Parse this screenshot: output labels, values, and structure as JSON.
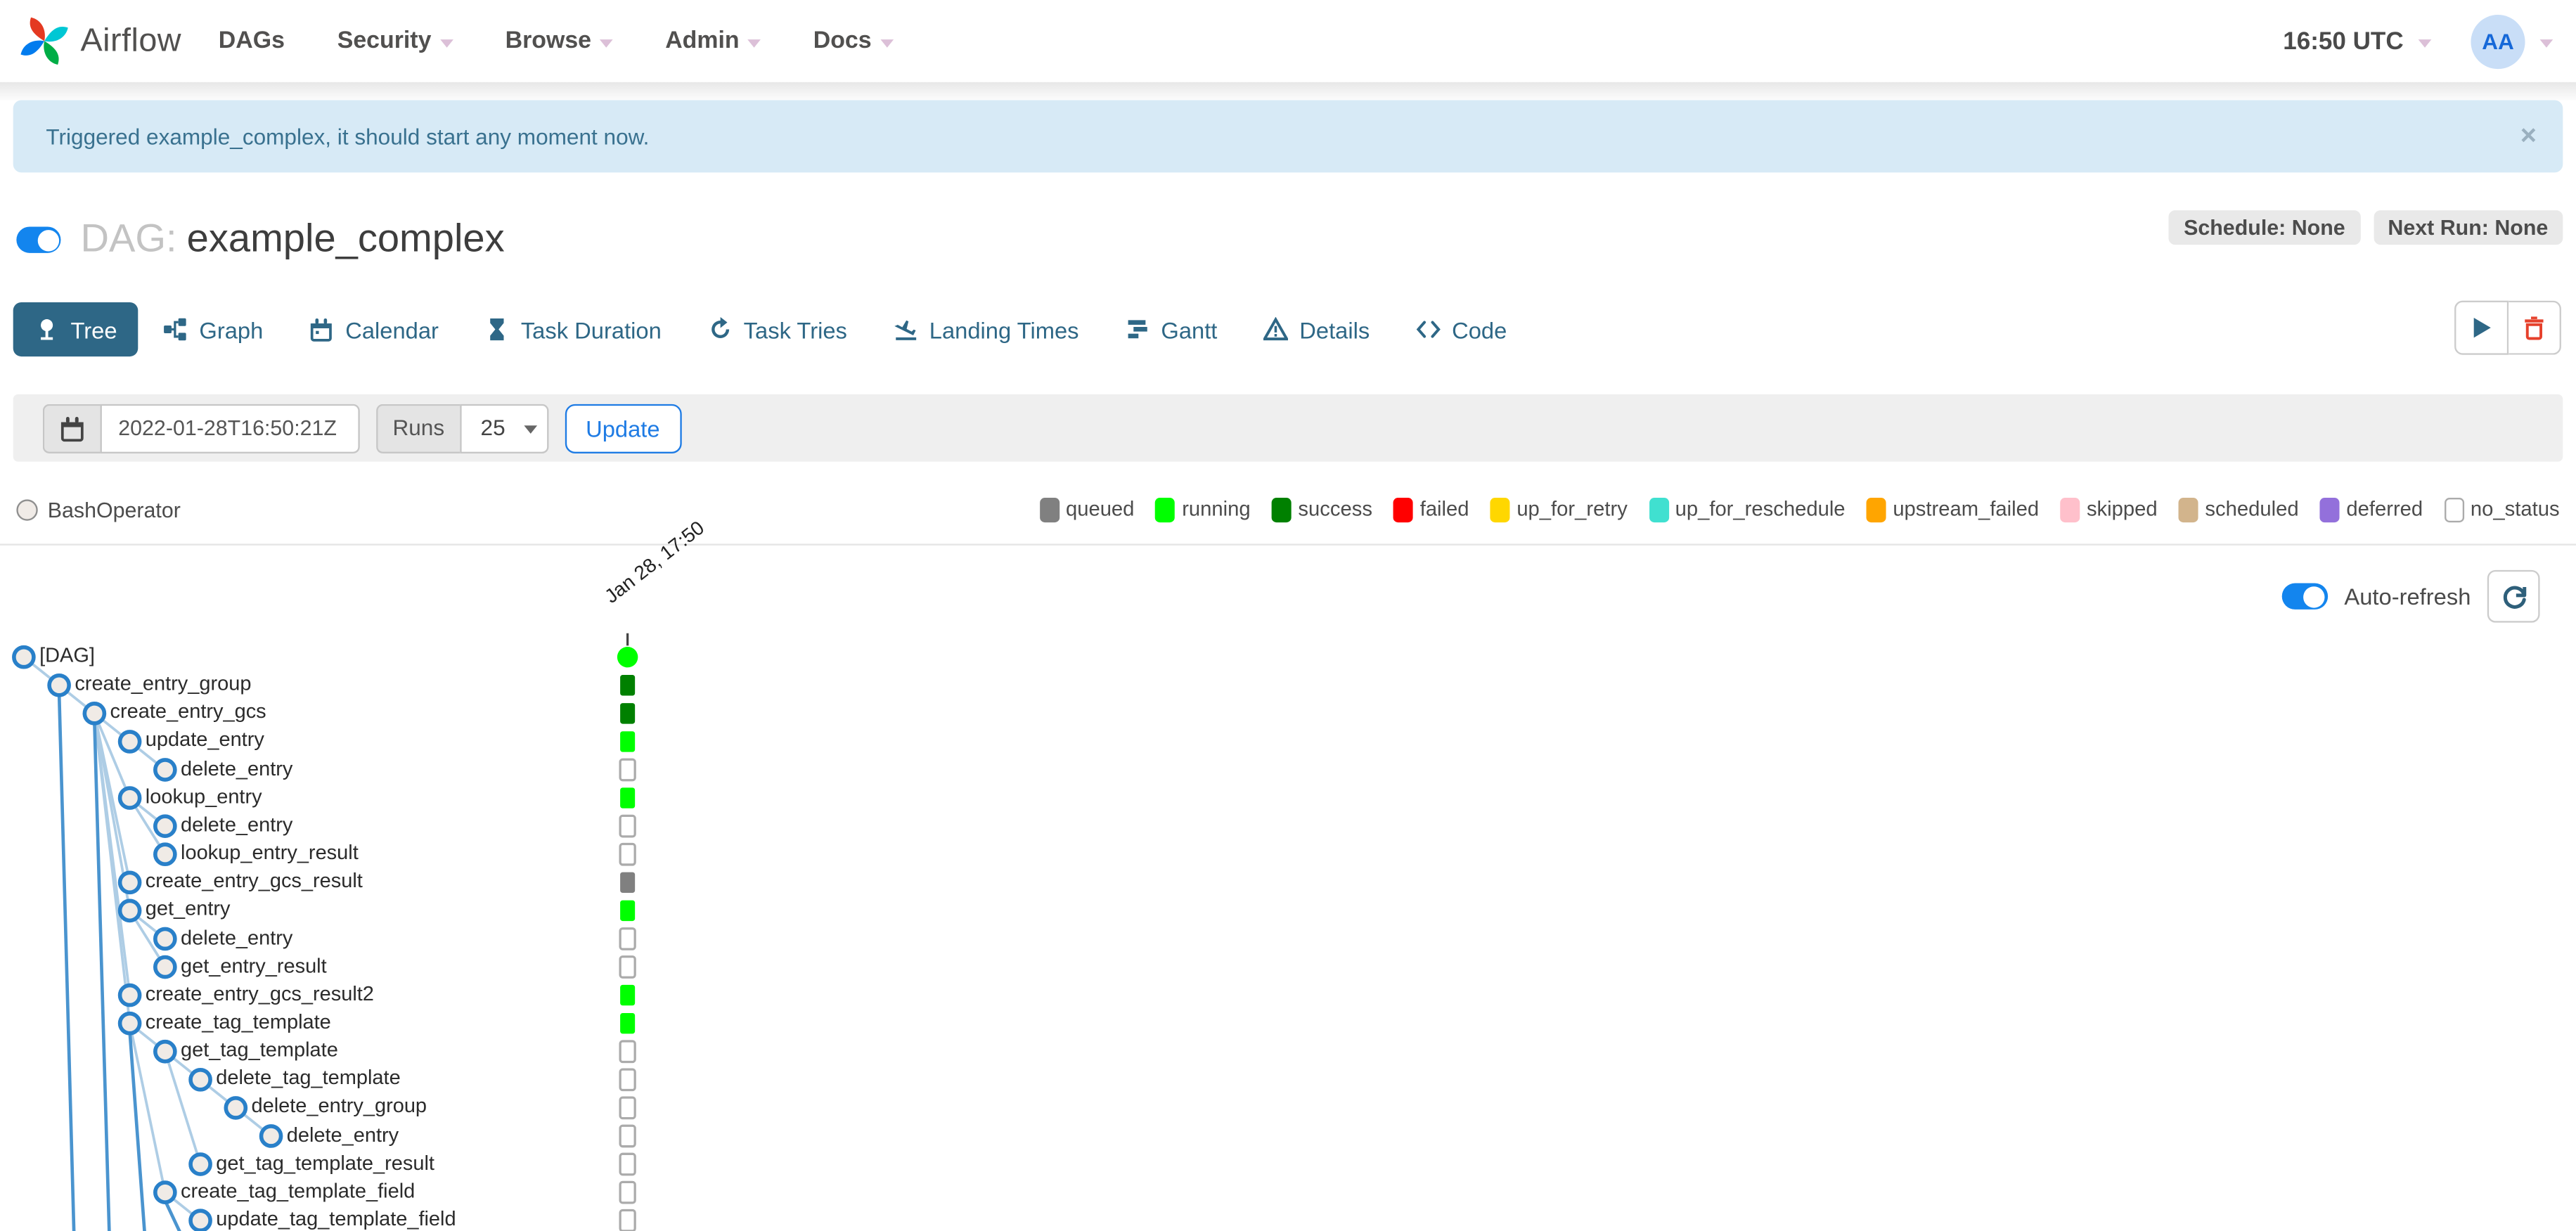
{
  "navbar": {
    "brand": "Airflow",
    "items": [
      {
        "label": "DAGs",
        "has_caret": false
      },
      {
        "label": "Security",
        "has_caret": true
      },
      {
        "label": "Browse",
        "has_caret": true
      },
      {
        "label": "Admin",
        "has_caret": true
      },
      {
        "label": "Docs",
        "has_caret": true
      }
    ],
    "clock": "16:50 UTC",
    "avatar_initials": "AA"
  },
  "alert": {
    "message": "Triggered example_complex, it should start any moment now.",
    "close_label": "×"
  },
  "dag_header": {
    "prefix": "DAG:",
    "dag_id": "example_complex",
    "pause_toggle_on": true,
    "schedule_badge": "Schedule: None",
    "next_run_badge": "Next Run: None"
  },
  "tabs": [
    {
      "label": "Tree",
      "icon": "tree-icon",
      "active": true
    },
    {
      "label": "Graph",
      "icon": "graph-icon",
      "active": false
    },
    {
      "label": "Calendar",
      "icon": "calendar-icon",
      "active": false
    },
    {
      "label": "Task Duration",
      "icon": "hourglass-icon",
      "active": false
    },
    {
      "label": "Task Tries",
      "icon": "retry-icon",
      "active": false
    },
    {
      "label": "Landing Times",
      "icon": "landing-icon",
      "active": false
    },
    {
      "label": "Gantt",
      "icon": "gantt-icon",
      "active": false
    },
    {
      "label": "Details",
      "icon": "details-icon",
      "active": false
    },
    {
      "label": "Code",
      "icon": "code-icon",
      "active": false
    }
  ],
  "filter": {
    "date_value": "2022-01-28T16:50:21Z",
    "runs_label": "Runs",
    "runs_value": "25",
    "update_label": "Update"
  },
  "operator_legend": [
    {
      "label": "BashOperator",
      "fill": "#f0ebe7",
      "border": "#8f8f8f"
    }
  ],
  "status_legend": [
    {
      "label": "queued",
      "color": "#808080"
    },
    {
      "label": "running",
      "color": "#00FF00"
    },
    {
      "label": "success",
      "color": "#008000"
    },
    {
      "label": "failed",
      "color": "#FF0000"
    },
    {
      "label": "up_for_retry",
      "color": "#FFD700"
    },
    {
      "label": "up_for_reschedule",
      "color": "#40E0D0"
    },
    {
      "label": "upstream_failed",
      "color": "#FFA500"
    },
    {
      "label": "skipped",
      "color": "#FFC0CB"
    },
    {
      "label": "scheduled",
      "color": "#D2B48C"
    },
    {
      "label": "deferred",
      "color": "#9370DB"
    },
    {
      "label": "no_status",
      "color": "#FFFFFF",
      "border": "#ababab"
    }
  ],
  "tree": {
    "auto_refresh_label": "Auto-refresh",
    "column_label": "Jan 28, 17:50",
    "tasks": [
      {
        "name": "[DAG]",
        "level": 0,
        "status": "running",
        "shape": "circle"
      },
      {
        "name": "create_entry_group",
        "level": 1,
        "status": "success",
        "continues_below": true
      },
      {
        "name": "create_entry_gcs",
        "level": 2,
        "status": "success",
        "continues_below": true
      },
      {
        "name": "update_entry",
        "level": 3,
        "status": "running"
      },
      {
        "name": "delete_entry",
        "level": 4,
        "status": "no_status"
      },
      {
        "name": "lookup_entry",
        "level": 3,
        "status": "running"
      },
      {
        "name": "delete_entry",
        "level": 4,
        "status": "no_status"
      },
      {
        "name": "lookup_entry_result",
        "level": 4,
        "status": "no_status"
      },
      {
        "name": "create_entry_gcs_result",
        "level": 3,
        "status": "queued"
      },
      {
        "name": "get_entry",
        "level": 3,
        "status": "running"
      },
      {
        "name": "delete_entry",
        "level": 4,
        "status": "no_status"
      },
      {
        "name": "get_entry_result",
        "level": 4,
        "status": "no_status"
      },
      {
        "name": "create_entry_gcs_result2",
        "level": 3,
        "status": "running"
      },
      {
        "name": "create_tag_template",
        "level": 3,
        "status": "running",
        "continues_below": true
      },
      {
        "name": "get_tag_template",
        "level": 4,
        "status": "no_status"
      },
      {
        "name": "delete_tag_template",
        "level": 5,
        "status": "no_status"
      },
      {
        "name": "delete_entry_group",
        "level": 6,
        "status": "no_status"
      },
      {
        "name": "delete_entry",
        "level": 7,
        "status": "no_status"
      },
      {
        "name": "get_tag_template_result",
        "level": 5,
        "status": "no_status"
      },
      {
        "name": "create_tag_template_field",
        "level": 4,
        "status": "no_status",
        "continues_below": true
      },
      {
        "name": "update_tag_template_field",
        "level": 5,
        "status": "no_status"
      }
    ]
  },
  "colors": {
    "accent_blue": "#1385ee",
    "tab_active": "#2e6786",
    "danger_red": "#e6412c",
    "node_fill": "#f0ebe6",
    "node_stroke": "#2980c9",
    "edge_light": "#aecde5",
    "edge_dark": "#4a94cf",
    "dag_run_running": "#00FF00"
  }
}
